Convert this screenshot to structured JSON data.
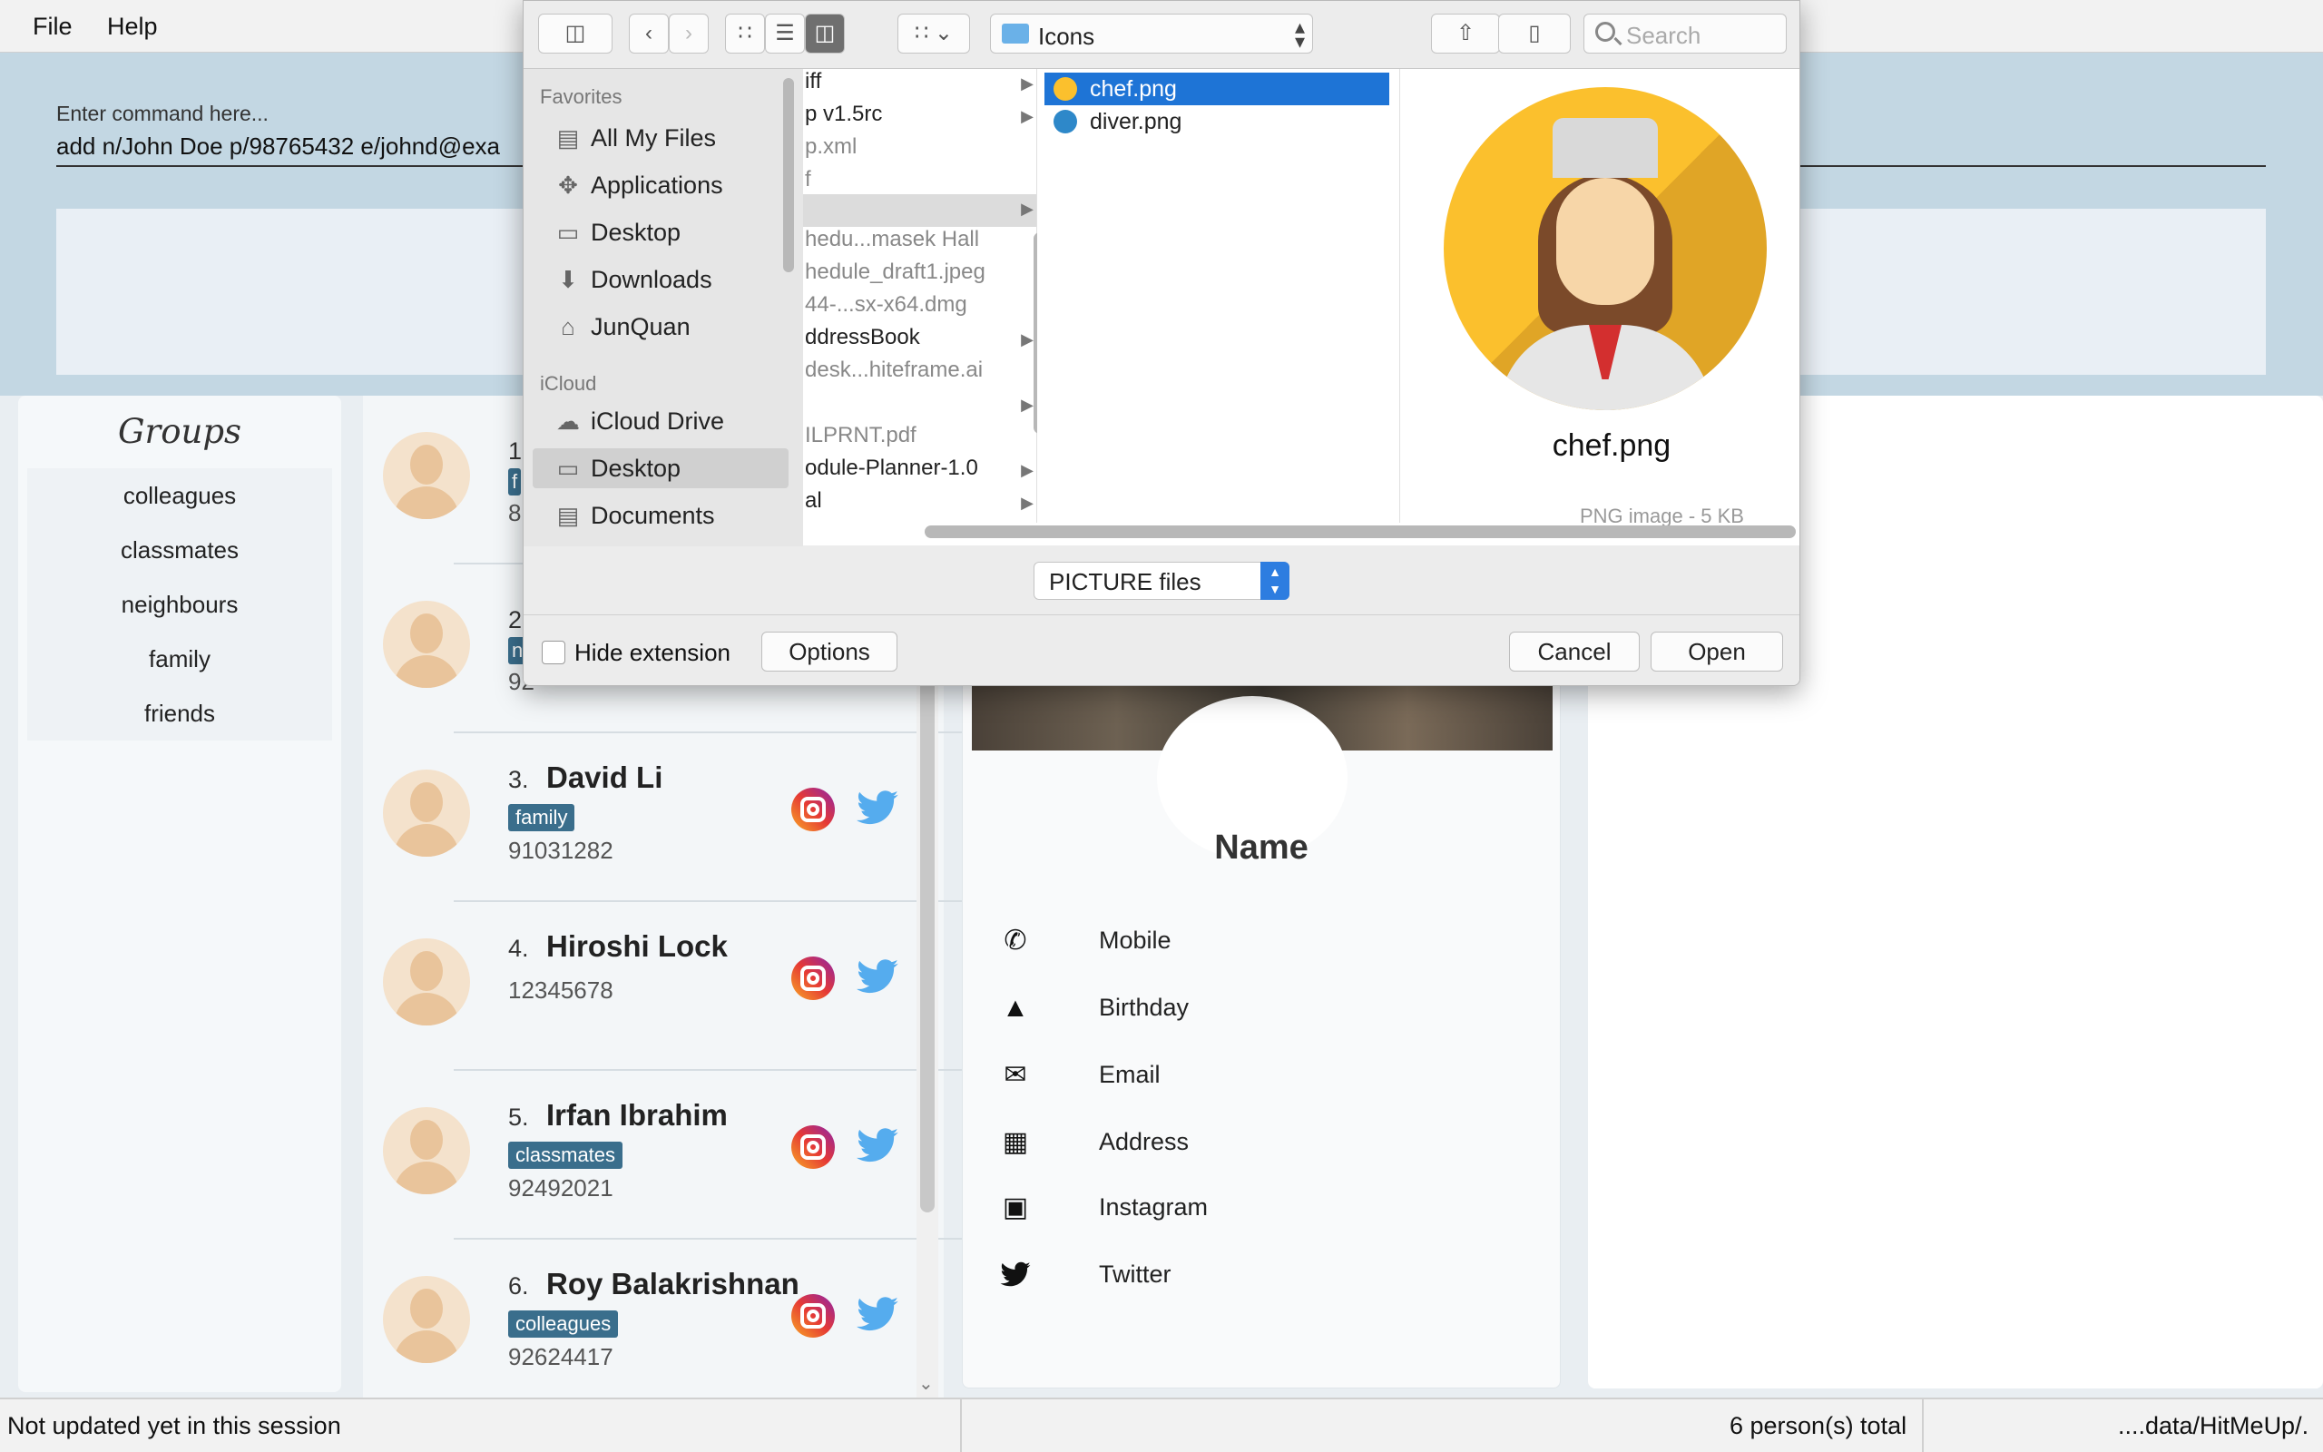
{
  "menubar": {
    "file": "File",
    "help": "Help"
  },
  "command": {
    "hint": "Enter command here...",
    "value": "add n/John Doe p/98765432 e/johnd@exa"
  },
  "groups": {
    "title": "Groups",
    "items": [
      "colleagues",
      "classmates",
      "neighbours",
      "family",
      "friends"
    ]
  },
  "contacts": [
    {
      "index": "3.",
      "name": "David Li",
      "tag": "family",
      "phone": "91031282"
    },
    {
      "index": "4.",
      "name": "Hiroshi Lock",
      "tag": "",
      "phone": "12345678"
    },
    {
      "index": "5.",
      "name": "Irfan Ibrahim",
      "tag": "classmates",
      "phone": "92492021"
    },
    {
      "index": "6.",
      "name": "Roy Balakrishnan",
      "tag": "colleagues",
      "phone": "92624417"
    }
  ],
  "contacts_partial": [
    {
      "index": "1.",
      "tag": "f",
      "phone": "8"
    },
    {
      "index": "2.",
      "tag": "n",
      "phone": "92"
    }
  ],
  "detail": {
    "name": "Name",
    "rows": [
      {
        "icon": "phone-icon",
        "label": "Mobile"
      },
      {
        "icon": "cake-icon",
        "label": "Birthday"
      },
      {
        "icon": "mail-icon",
        "label": "Email"
      },
      {
        "icon": "map-icon",
        "label": "Address"
      },
      {
        "icon": "instagram-icon",
        "label": "Instagram"
      },
      {
        "icon": "twitter-icon",
        "label": "Twitter"
      }
    ]
  },
  "status": {
    "left": "Not updated yet in this session",
    "middle": "6 person(s) total",
    "right": "....data/HitMeUp/."
  },
  "dialog": {
    "location": "Icons",
    "search_placeholder": "Search",
    "sidebar": {
      "favorites_heading": "Favorites",
      "favorites": [
        "All My Files",
        "Applications",
        "Desktop",
        "Downloads",
        "JunQuan"
      ],
      "icloud_heading": "iCloud",
      "icloud": [
        "iCloud Drive",
        "Desktop",
        "Documents"
      ]
    },
    "column1": [
      "iff",
      "p v1.5rc",
      "p.xml",
      "f",
      "",
      "hedu...masek Hall",
      "hedule_draft1.jpeg",
      "44-...sx-x64.dmg",
      "ddressBook",
      "desk...hiteframe.ai",
      "",
      "ILPRNT.pdf",
      "odule-Planner-1.0",
      "al"
    ],
    "column2": [
      "chef.png",
      "diver.png"
    ],
    "preview_name": "chef.png",
    "preview_sub": "PNG image - 5 KB",
    "filter": "PICTURE files",
    "hide_extension": "Hide extension",
    "options": "Options",
    "cancel": "Cancel",
    "open": "Open"
  },
  "colors": {
    "accent": "#1e74d6",
    "tag": "#3a6e8c",
    "command_bg": "#c3d7e3",
    "twitter": "#55acee"
  }
}
